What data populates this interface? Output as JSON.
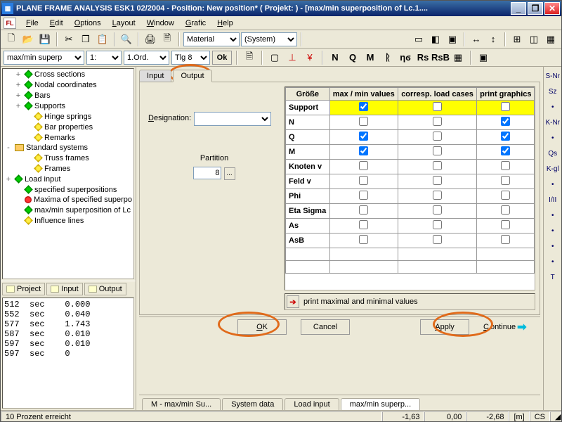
{
  "title": "PLANE FRAME ANALYSIS ESK1 02/2004 - Position: New position* ( Projekt:  )  - [max/min superposition of Lc.1....",
  "menu": [
    "File",
    "Edit",
    "Options",
    "Layout",
    "Window",
    "Grafic",
    "Help"
  ],
  "toolbar1": {
    "material_label": "Material",
    "system_label": "(System)"
  },
  "toolbar2": {
    "sel1": "max/min superp",
    "sel2": "1:",
    "sel3": "1.Ord.",
    "sel4": "Tlg 8",
    "ok": "Ok"
  },
  "tree": [
    {
      "ind": 1,
      "tw": "+",
      "icon": "g",
      "label": "Cross sections"
    },
    {
      "ind": 1,
      "tw": "+",
      "icon": "g",
      "label": "Nodal coordinates"
    },
    {
      "ind": 1,
      "tw": "+",
      "icon": "g",
      "label": "Bars"
    },
    {
      "ind": 1,
      "tw": "+",
      "icon": "g",
      "label": "Supports"
    },
    {
      "ind": 2,
      "tw": "",
      "icon": "y",
      "label": "Hinge springs"
    },
    {
      "ind": 2,
      "tw": "",
      "icon": "y",
      "label": "Bar properties"
    },
    {
      "ind": 2,
      "tw": "",
      "icon": "y",
      "label": "Remarks"
    },
    {
      "ind": 0,
      "tw": "-",
      "icon": "f",
      "label": "Standard systems"
    },
    {
      "ind": 2,
      "tw": "",
      "icon": "y",
      "label": "Truss frames"
    },
    {
      "ind": 2,
      "tw": "",
      "icon": "y",
      "label": "Frames"
    },
    {
      "ind": 0,
      "tw": "+",
      "icon": "g",
      "label": "Load input"
    },
    {
      "ind": 1,
      "tw": "",
      "icon": "g",
      "label": "specified superpositions"
    },
    {
      "ind": 1,
      "tw": "",
      "icon": "r",
      "label": "Maxima of specified superpo"
    },
    {
      "ind": 1,
      "tw": "",
      "icon": "g",
      "label": "max/min superposition of Lc"
    },
    {
      "ind": 1,
      "tw": "",
      "icon": "y",
      "label": "Influence lines"
    }
  ],
  "proj_tabs": [
    "Project",
    "Input",
    "Output"
  ],
  "log": [
    "512  sec    0.000",
    "552  sec    0.040",
    "577  sec    1.743",
    "587  sec    0.010",
    "597  sec    0.010",
    "597  sec    0"
  ],
  "io_tabs": {
    "input": "Input",
    "output": "Output"
  },
  "form": {
    "designation_label": "Designation:",
    "designation_value": "",
    "partition_label": "Partition",
    "partition_value": "8"
  },
  "grid": {
    "headers": [
      "Größe",
      "max / min values",
      "corresp. load cases",
      "print graphics"
    ],
    "rows": [
      {
        "label": "Support",
        "c1": true,
        "c2": false,
        "c3": false,
        "hl": true
      },
      {
        "label": "N",
        "c1": false,
        "c2": false,
        "c3": true
      },
      {
        "label": "Q",
        "c1": true,
        "c2": false,
        "c3": true
      },
      {
        "label": "M",
        "c1": true,
        "c2": false,
        "c3": true
      },
      {
        "label": "Knoten v",
        "c1": false,
        "c2": false,
        "c3": false
      },
      {
        "label": "Feld  v",
        "c1": false,
        "c2": false,
        "c3": false
      },
      {
        "label": "Phi",
        "c1": false,
        "c2": false,
        "c3": false
      },
      {
        "label": "Eta Sigma",
        "c1": false,
        "c2": false,
        "c3": false
      },
      {
        "label": "As",
        "c1": false,
        "c2": false,
        "c3": false
      },
      {
        "label": "AsB",
        "c1": false,
        "c2": false,
        "c3": false
      },
      {
        "label": "",
        "c1": null,
        "c2": null,
        "c3": null
      },
      {
        "label": "",
        "c1": null,
        "c2": null,
        "c3": null
      }
    ],
    "print_line": "print maximal and minimal values"
  },
  "buttons": {
    "ok": "OK",
    "cancel": "Cancel",
    "apply": "Apply",
    "continue": "Continue"
  },
  "bottom_tabs": [
    "M - max/min Su...",
    "System data",
    "Load input",
    "max/min superp..."
  ],
  "right_strip": [
    "S-Nr",
    "Sz",
    "",
    "K-Nr",
    "",
    "Qs",
    "K-gl",
    "",
    "I/II",
    "",
    "",
    "",
    "",
    "T"
  ],
  "status": {
    "left": "10 Prozent erreicht",
    "v1": "-1,63",
    "v2": "0,00",
    "v3": "-2,68",
    "unit": "[m]",
    "cs": "CS"
  }
}
